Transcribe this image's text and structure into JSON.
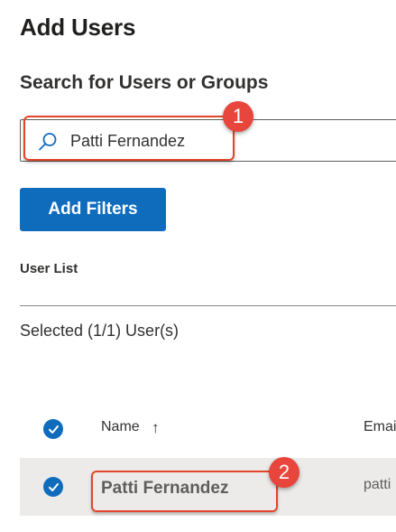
{
  "page": {
    "title": "Add Users",
    "search_section_title": "Search for Users or Groups"
  },
  "search": {
    "value": "Patti Fernandez",
    "icon": "search-icon"
  },
  "filters": {
    "add_filters_label": "Add Filters"
  },
  "user_list": {
    "label": "User List",
    "selected_count": "Selected (1/1) User(s)",
    "columns": {
      "name": "Name",
      "name_sort": "↑",
      "email": "Emai"
    },
    "rows": [
      {
        "name": "Patti Fernandez",
        "email": "patti",
        "selected": true
      }
    ]
  },
  "annotations": {
    "step_1": "1",
    "step_2": "2"
  },
  "colors": {
    "accent": "#0f6cbd",
    "callout": "#e8453c",
    "row_selected": "#edebe9"
  }
}
